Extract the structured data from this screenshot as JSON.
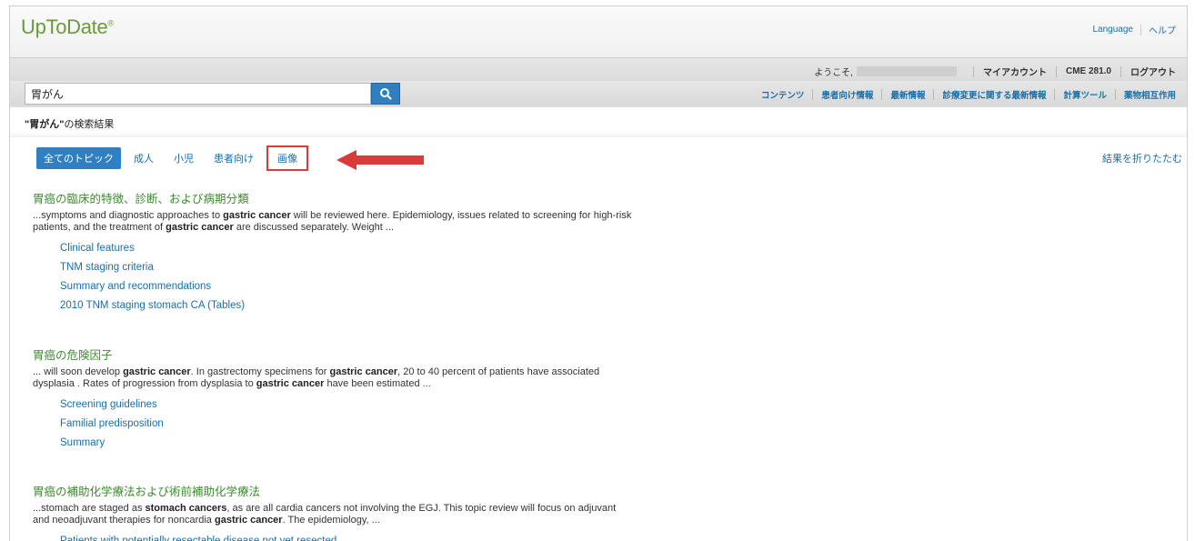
{
  "header": {
    "logo": "UpToDate",
    "logo_mark": "®",
    "language": "Language",
    "help": "ヘルプ"
  },
  "account": {
    "welcome": "ようこそ,",
    "my_account": "マイアカウント",
    "cme": "CME 281.0",
    "logout": "ログアウト"
  },
  "search": {
    "value": "胃がん",
    "button_icon": "search-icon"
  },
  "nav": {
    "items": [
      "コンテンツ",
      "患者向け情報",
      "最新情報",
      "診療変更に関する最新情報",
      "計算ツール",
      "薬物相互作用"
    ]
  },
  "results_title": {
    "query": "\"胃がん\"",
    "suffix": "の検索結果"
  },
  "filters": {
    "tabs": [
      "全てのトピック",
      "成人",
      "小児",
      "患者向け",
      "画像"
    ],
    "collapse": "結果を折りたたむ"
  },
  "annotation": {
    "arrow_color": "#d93a3a"
  },
  "results": [
    {
      "title": "胃癌の臨床的特徴、診断、および病期分類",
      "snippet_html": "...symptoms and diagnostic approaches to <b>gastric cancer</b> will be reviewed here. Epidemiology, issues related to screening for high-risk patients, and the treatment of <b>gastric cancer</b> are discussed separately. Weight ...",
      "links": [
        "Clinical features",
        "TNM staging criteria",
        "Summary and recommendations",
        "2010 TNM staging stomach CA (Tables)"
      ]
    },
    {
      "title": "胃癌の危険因子",
      "snippet_html": "... will soon develop <b>gastric cancer</b>. In gastrectomy specimens for <b>gastric cancer</b>, 20 to 40 percent of patients have associated dysplasia . Rates of progression from dysplasia to <b>gastric cancer</b> have been estimated ...",
      "links": [
        "Screening guidelines",
        "Familial predisposition",
        "Summary"
      ]
    },
    {
      "title": "胃癌の補助化学療法および術前補助化学療法",
      "snippet_html": "...stomach are staged as <b>stomach cancers</b>, as are all cardia cancers not involving the EGJ. This topic review will focus on adjuvant and neoadjuvant therapies for noncardia <b>gastric cancer</b>. The epidemiology, ...",
      "links": [
        "Patients with potentially resectable disease not yet resected"
      ]
    }
  ],
  "colors": {
    "brand_green": "#6a9a3a",
    "link_blue": "#1a6fa8",
    "title_green": "#3d8b2f",
    "active_tab": "#2f7fc1"
  }
}
